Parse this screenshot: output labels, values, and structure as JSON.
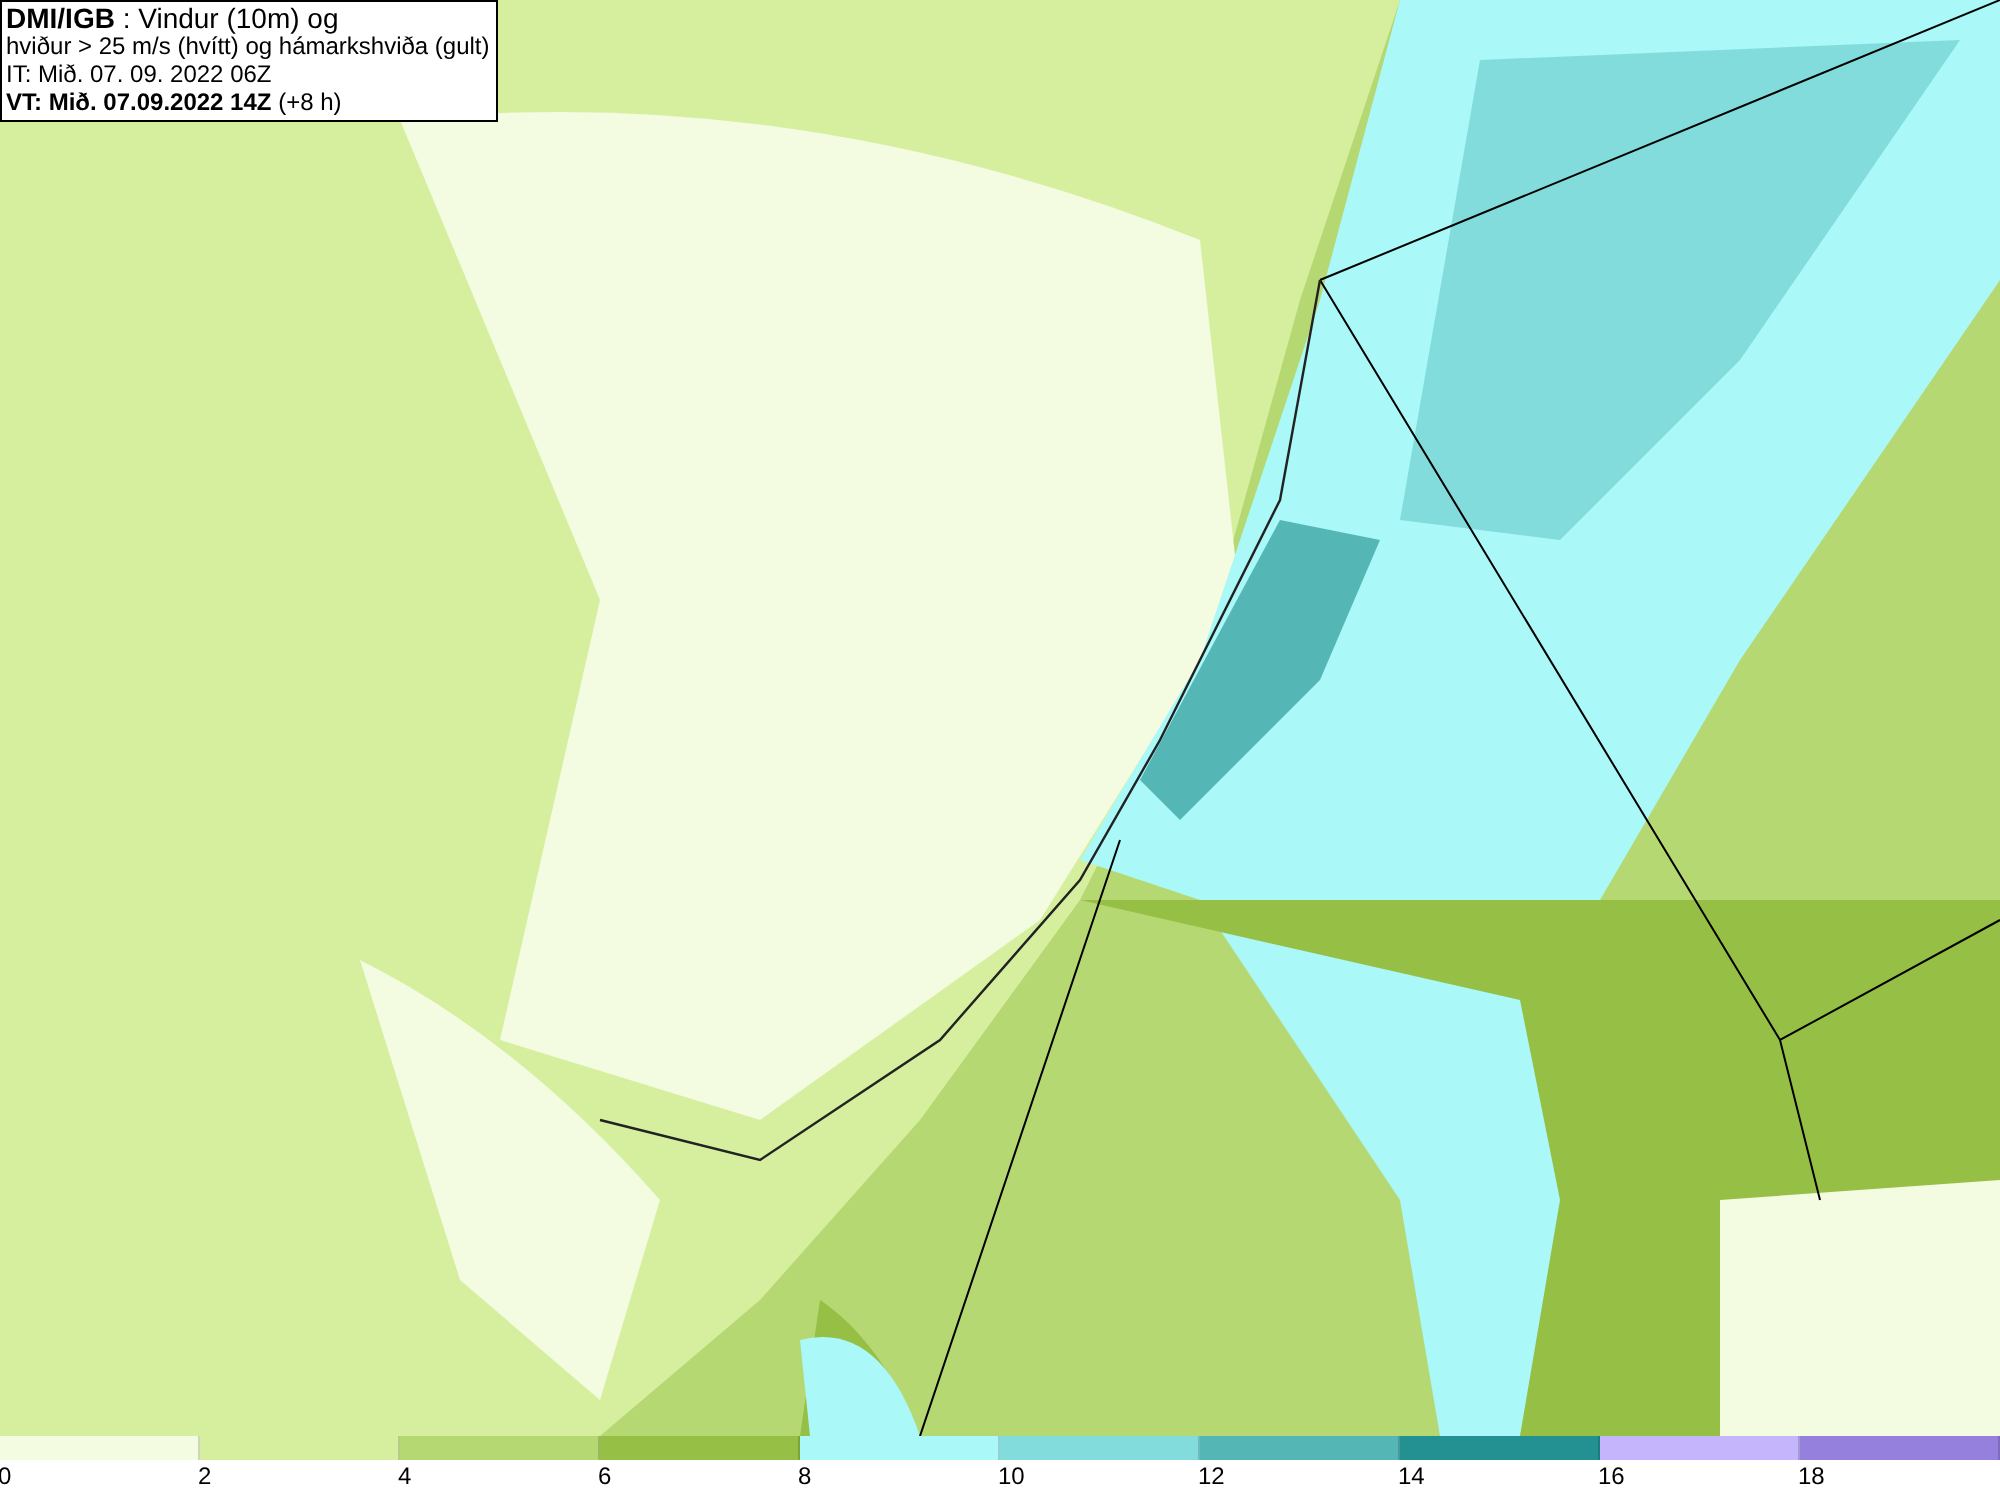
{
  "title_box": {
    "lines": [
      "**DMI/IGB** : Vindur (10m) og",
      "hviður > 25 m/s (hvítt) og hámarkshviða (gult)",
      "IT: Mið. 07. 09. 2022 06Z",
      "**VT: Mið. 07.09.2022 14Z** (+8 h)"
    ]
  },
  "legend": [
    {
      "label": "0",
      "color": "#f3fbe0"
    },
    {
      "label": "2",
      "color": "#d6ef9f"
    },
    {
      "label": "4",
      "color": "#b6d873"
    },
    {
      "label": "6",
      "color": "#96bf45"
    },
    {
      "label": "8",
      "color": "#aaf8f8"
    },
    {
      "label": "10",
      "color": "#83dcdc"
    },
    {
      "label": "12",
      "color": "#55b6b6"
    },
    {
      "label": "14",
      "color": "#239191"
    },
    {
      "label": "16",
      "color": "#c4b5fc"
    },
    {
      "label": "18",
      "color": "#9580de"
    }
  ]
}
